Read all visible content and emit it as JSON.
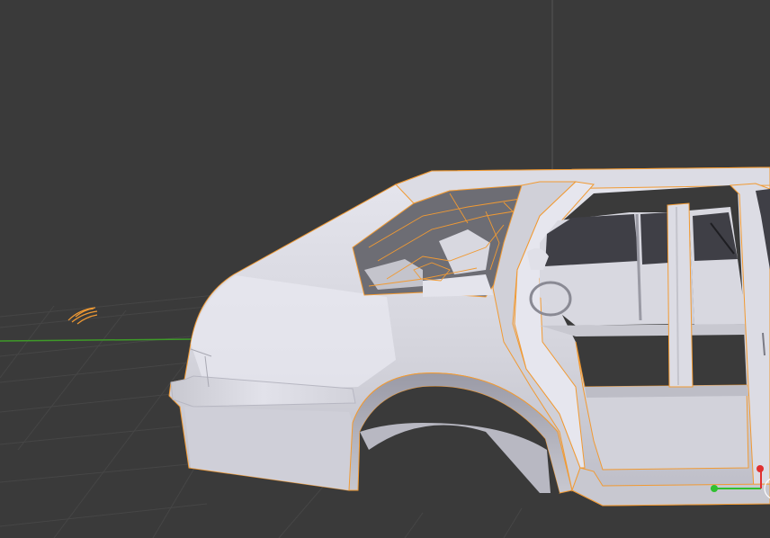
{
  "viewport": {
    "mode": "3d-viewport",
    "background": "#3a3a3a",
    "grid_color": "#444444",
    "x_axis_color": "#3e9a28",
    "z_axis_color": "#4a4a4a",
    "selection_outline_color": "#f19a33",
    "mesh_color": "#d7d7df",
    "gizmo_colors": {
      "x": "#e03030",
      "y": "#30c030",
      "z": "#3050e0"
    }
  },
  "objects": [
    {
      "name": "car-body",
      "type": "mesh",
      "selected": true
    },
    {
      "name": "light-lamp",
      "type": "light",
      "selected": true
    }
  ]
}
